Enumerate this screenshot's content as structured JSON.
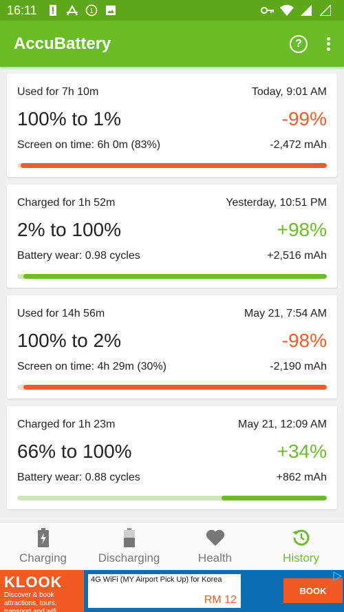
{
  "status_bar": {
    "time": "16:11"
  },
  "app": {
    "title": "AccuBattery"
  },
  "sessions": [
    {
      "duration": "Used for 7h 10m",
      "date": "Today, 9:01 AM",
      "range": "100% to 1%",
      "percent": "-99%",
      "detail": "Screen on time: 6h 0m (83%)",
      "mah": "-2,472 mAh",
      "type": "discharge",
      "bar_fill": 0.99
    },
    {
      "duration": "Charged for 1h 52m",
      "date": "Yesterday, 10:51 PM",
      "range": "2% to 100%",
      "percent": "+98%",
      "detail": "Battery wear: 0.98 cycles",
      "mah": "+2,516 mAh",
      "type": "charge",
      "bar_fill": 0.98
    },
    {
      "duration": "Used for 14h 56m",
      "date": "May 21, 7:54 AM",
      "range": "100% to 2%",
      "percent": "-98%",
      "detail": "Screen on time: 4h 29m (30%)",
      "mah": "-2,190 mAh",
      "type": "discharge",
      "bar_fill": 0.98
    },
    {
      "duration": "Charged for 1h 23m",
      "date": "May 21, 12:09 AM",
      "range": "66% to 100%",
      "percent": "+34%",
      "detail": "Battery wear: 0.88 cycles",
      "mah": "+862 mAh",
      "type": "charge",
      "bar_fill": 0.34
    }
  ],
  "nav": {
    "charging": "Charging",
    "discharging": "Discharging",
    "health": "Health",
    "history": "History",
    "active": "history"
  },
  "ad": {
    "brand": "KLOOK",
    "tagline": "Discover & book attractions, tours, transport and wifi",
    "headline": "4G WiFi (MY Airport Pick Up) for Korea",
    "price": "RM 12",
    "cta": "BOOK"
  },
  "colors": {
    "accent": "#6abd26",
    "negative": "#f15a29",
    "positive": "#6abd26"
  }
}
